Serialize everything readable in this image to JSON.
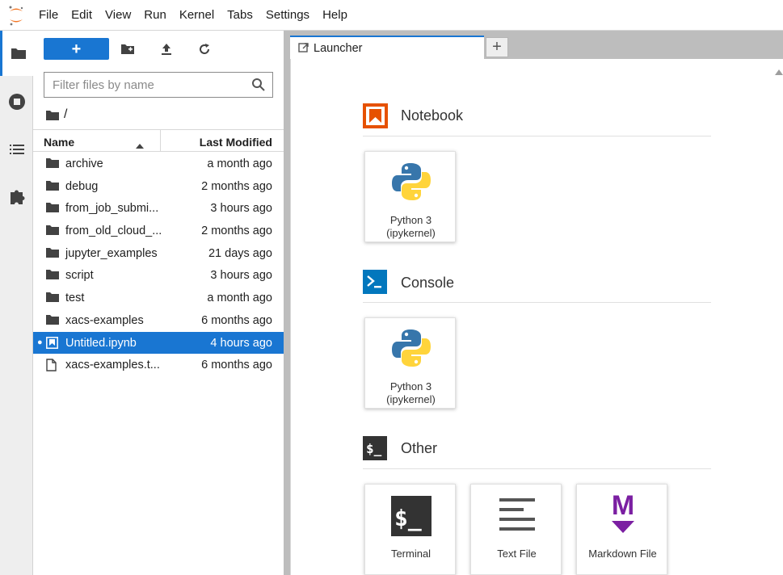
{
  "menubar": {
    "items": [
      "File",
      "Edit",
      "View",
      "Run",
      "Kernel",
      "Tabs",
      "Settings",
      "Help"
    ]
  },
  "activity_bar": {
    "items": [
      "folder-icon",
      "running-icon",
      "toc-icon",
      "extension-icon"
    ],
    "active": "folder-icon"
  },
  "file_browser": {
    "new_button": "+",
    "filter_placeholder": "Filter files by name",
    "breadcrumb": "/",
    "columns": {
      "name": "Name",
      "modified": "Last Modified"
    },
    "rows": [
      {
        "name": "archive",
        "modified": "a month ago",
        "type": "folder"
      },
      {
        "name": "debug",
        "modified": "2 months ago",
        "type": "folder"
      },
      {
        "name": "from_job_submi...",
        "modified": "3 hours ago",
        "type": "folder"
      },
      {
        "name": "from_old_cloud_...",
        "modified": "2 months ago",
        "type": "folder"
      },
      {
        "name": "jupyter_examples",
        "modified": "21 days ago",
        "type": "folder"
      },
      {
        "name": "script",
        "modified": "3 hours ago",
        "type": "folder"
      },
      {
        "name": "test",
        "modified": "a month ago",
        "type": "folder"
      },
      {
        "name": "xacs-examples",
        "modified": "6 months ago",
        "type": "folder"
      },
      {
        "name": "Untitled.ipynb",
        "modified": "4 hours ago",
        "type": "notebook",
        "selected": true
      },
      {
        "name": "xacs-examples.t...",
        "modified": "6 months ago",
        "type": "file"
      }
    ]
  },
  "tabs": [
    {
      "label": "Launcher",
      "active": true
    }
  ],
  "tab_add": "+",
  "launcher": {
    "sections": [
      {
        "title": "Notebook",
        "cards": [
          {
            "label_line1": "Python 3",
            "label_line2": "(ipykernel)"
          }
        ]
      },
      {
        "title": "Console",
        "cards": [
          {
            "label_line1": "Python 3",
            "label_line2": "(ipykernel)"
          }
        ]
      },
      {
        "title": "Other",
        "cards": [
          {
            "label": "Terminal"
          },
          {
            "label": "Text File"
          },
          {
            "label": "Markdown File"
          }
        ]
      }
    ]
  },
  "colors": {
    "accent": "#1976d2",
    "notebook": "#e65100",
    "console": "#0277bd",
    "markdown": "#7b1fa2",
    "terminal": "#333333"
  }
}
